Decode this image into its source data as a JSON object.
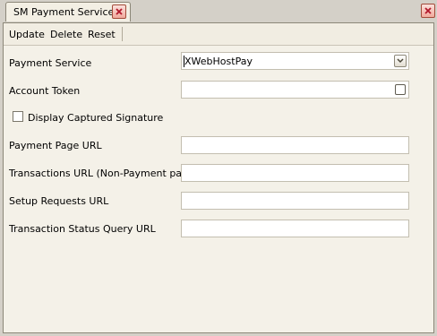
{
  "tab": {
    "title": "SM Payment Services"
  },
  "toolbar": {
    "update_label": "Update",
    "delete_label": "Delete",
    "reset_label": "Reset"
  },
  "form": {
    "payment_service": {
      "label": "Payment Service",
      "value": "XWebHostPay"
    },
    "account_token": {
      "label": "Account Token",
      "value": "",
      "checked": false
    },
    "display_signature": {
      "label": "Display Captured Signature",
      "checked": false
    },
    "payment_page_url": {
      "label": "Payment Page URL",
      "value": ""
    },
    "transactions_url": {
      "label": "Transactions URL (Non-Payment page)",
      "value": ""
    },
    "setup_requests_url": {
      "label": "Setup Requests URL",
      "value": ""
    },
    "transaction_status_url": {
      "label": "Transaction Status Query URL",
      "value": ""
    }
  },
  "icons": {
    "tab_close": "close-icon",
    "window_close": "close-icon",
    "dropdown": "chevron-down-icon"
  },
  "colors": {
    "panel_bg": "#f4f1e8",
    "window_bg": "#d4d0c8",
    "close_red": "#d9534f"
  }
}
